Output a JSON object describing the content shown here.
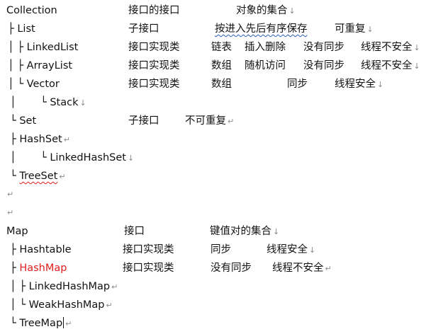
{
  "marks": {
    "paragraph": "↵",
    "line_break": "↓"
  },
  "collection": {
    "root": {
      "tree": "Collection",
      "c1": "接口的接口",
      "c2": "对象的集合"
    },
    "list": {
      "tree": "├ List",
      "c1": "子接口",
      "c2": "按进入先后有序保存",
      "c3": "可重复"
    },
    "linkedlist": {
      "tree": "│ ├ LinkedList",
      "c1": "接口实现类",
      "c2": "链表",
      "c3": "插入删除",
      "c4": "没有同步",
      "c5": "线程不安全"
    },
    "arraylist": {
      "tree": "│ ├ ArrayList",
      "c1": "接口实现类",
      "c2": "数组",
      "c3": "随机访问",
      "c4": "没有同步",
      "c5": "线程不安全"
    },
    "vector": {
      "tree": "│ └ Vector",
      "c1": "接口实现类",
      "c2": "数组",
      "c3": "同步",
      "c4": "线程安全"
    },
    "stack": {
      "bar": "│",
      "tree": "└ Stack"
    },
    "set": {
      "tree": "└ Set",
      "c1": "子接口",
      "c2": "不可重复"
    },
    "hashset": {
      "tree": "├ HashSet"
    },
    "linkedhashset": {
      "bar": "│",
      "tree": "└ LinkedHashSet"
    },
    "treeset": {
      "prefix": "└ ",
      "name": "TreeSet"
    }
  },
  "map": {
    "root": {
      "tree": "Map",
      "c1": "接口",
      "c2": "键值对的集合"
    },
    "hashtable": {
      "tree": "├ Hashtable",
      "c1": "接口实现类",
      "c2": "同步",
      "c3": "线程安全"
    },
    "hashmap": {
      "prefix": "├ ",
      "name": "HashMap",
      "c1": "接口实现类",
      "c2": "没有同步",
      "c3": "线程不安全"
    },
    "linkedhashmap": {
      "tree": "│ ├ LinkedHashMap"
    },
    "weakhashmap": {
      "tree": "│ └ WeakHashMap"
    },
    "treemap": {
      "tree": "└ TreeMap"
    }
  },
  "colors": {
    "text": "#111111",
    "highlight": "#e11d1d",
    "spellcheck_red": "#e11d1d",
    "grammar_blue": "#2f5db8",
    "format_mark": "#8a8a8a"
  }
}
